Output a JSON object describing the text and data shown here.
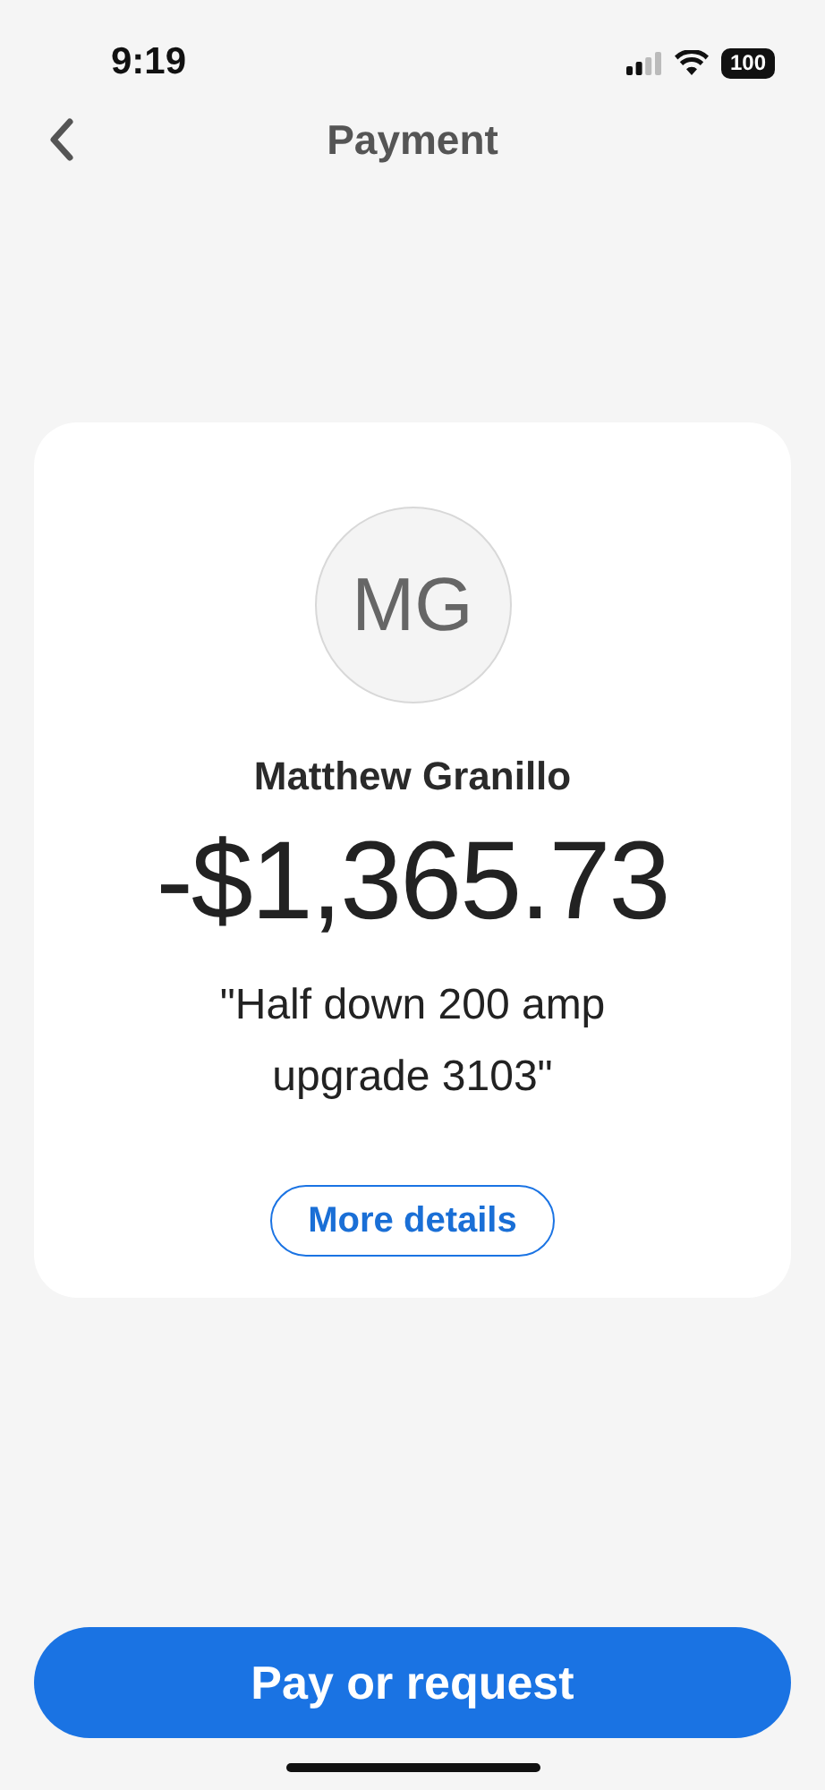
{
  "status_bar": {
    "time": "9:19",
    "battery": "100"
  },
  "header": {
    "title": "Payment"
  },
  "card": {
    "initials": "MG",
    "name": "Matthew Granillo",
    "amount": "-$1,365.73",
    "note": "\"Half down 200 amp upgrade 3103\"",
    "details_button": "More details"
  },
  "primary_button": "Pay or request"
}
